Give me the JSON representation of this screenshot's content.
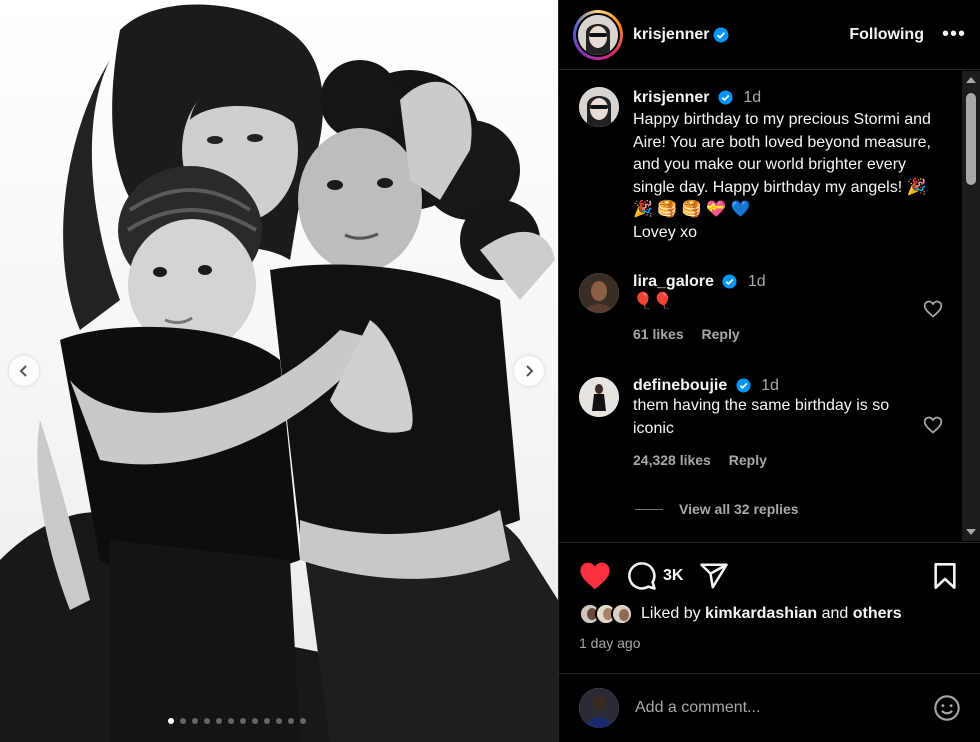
{
  "post": {
    "author": "krisjenner",
    "follow_label": "Following",
    "more_label": "•••"
  },
  "caption": {
    "username": "krisjenner",
    "time": "1d",
    "text": "Happy birthday to my precious Stormi and Aire! You are both loved beyond measure, and you make our world brighter every single day. Happy birthday my angels! 🎉 🎉 🥞 🥞 💝 💙",
    "signoff": "Lovey xo"
  },
  "comments": [
    {
      "username": "lira_galore",
      "time": "1d",
      "text": "🎈🎈",
      "likes": "61 likes",
      "reply_label": "Reply"
    },
    {
      "username": "defineboujie",
      "time": "1d",
      "text": "them having the same birthday is so iconic",
      "likes": "24,328 likes",
      "reply_label": "Reply"
    }
  ],
  "view_replies": "View all 32 replies",
  "actions": {
    "comment_count": "3K"
  },
  "liked_by": {
    "prefix": "Liked by",
    "user": "kimkardashian",
    "and": "and",
    "others": "others"
  },
  "posted_time": "1 day ago",
  "add_comment": {
    "placeholder": "Add a comment..."
  },
  "carousel": {
    "total_slides": 12,
    "active_slide": 0
  },
  "colors": {
    "like_red": "#ff3040",
    "verified_blue": "#0095f6",
    "secondary_text": "#a8a8a8"
  },
  "icons": [
    "verified-icon",
    "heart-icon",
    "comment-icon",
    "share-icon",
    "bookmark-icon",
    "emoji-icon",
    "chevron-left-icon",
    "chevron-right-icon"
  ]
}
